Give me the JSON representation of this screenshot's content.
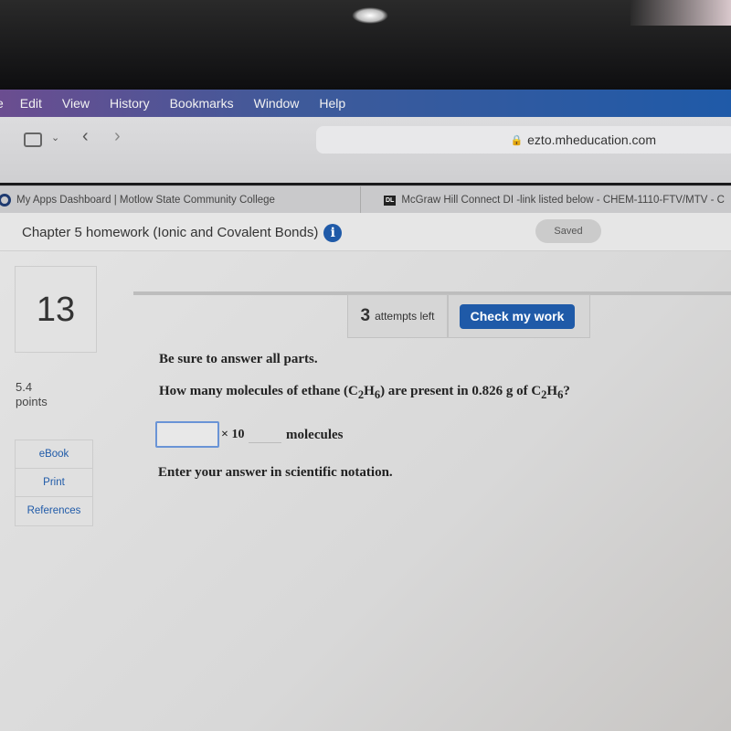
{
  "menu": [
    "Edit",
    "View",
    "History",
    "Bookmarks",
    "Window",
    "Help"
  ],
  "browser": {
    "url": "ezto.mheducation.com"
  },
  "tabs": [
    {
      "label": "My Apps Dashboard | Motlow State Community College"
    },
    {
      "label": "McGraw Hill Connect DI -link listed below - CHEM-1110-FTV/MTV - C",
      "favicon": "DL"
    }
  ],
  "header": {
    "title": "Chapter 5 homework (Ionic and Covalent Bonds)",
    "info_icon": "i",
    "status": "Saved"
  },
  "question": {
    "number": "13",
    "points_value": "5.4",
    "points_label": "points",
    "attempts_count": "3",
    "attempts_label": "attempts left",
    "check_button": "Check my work",
    "instruction": "Be sure to answer all parts.",
    "text_pre": "How many molecules of ethane (C",
    "sub1": "2",
    "text_h": "H",
    "sub2": "6",
    "text_mid": ") are present in 0.826 g of C",
    "sub3": "2",
    "text_h2": "H",
    "sub4": "6",
    "text_end": "?",
    "answer_value": "",
    "exponent_value": "",
    "times_ten": "× 10",
    "unit": "molecules",
    "hint": "Enter your answer in scientific notation."
  },
  "side_links": [
    "eBook",
    "Print",
    "References"
  ],
  "colors": {
    "accent": "#1f5aa8"
  }
}
